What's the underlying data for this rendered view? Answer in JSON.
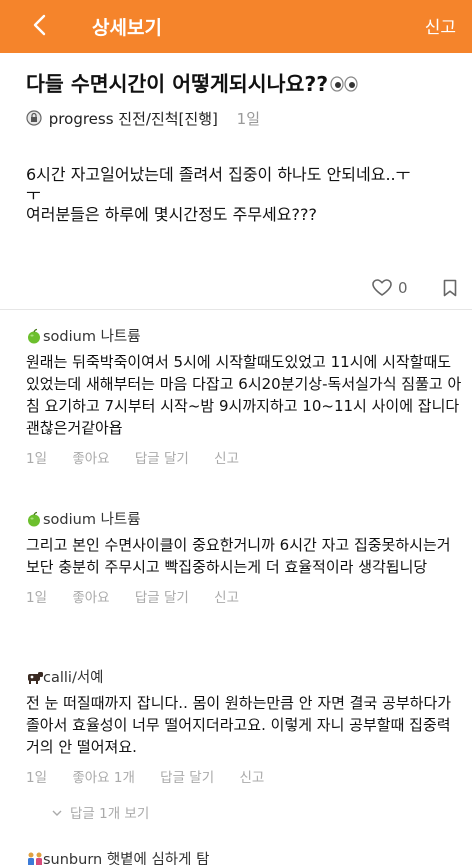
{
  "header": {
    "back_icon": "chevron-left-icon",
    "title": "상세보기",
    "report_label": "신고",
    "bg_color": "#f5842b"
  },
  "post": {
    "title": "다들 수면시간이 어떻게되시나요??",
    "title_emoji_icon": "eyes-icon",
    "author_icon": "lock-icon",
    "author": "progress 진전/진척[진행]",
    "time": "1일",
    "body_lines": [
      "6시간 자고일어났는데 졸려서 집중이 하나도 안되네요..ㅜ",
      "ㅜ",
      "여러분들은 하루에 몇시간정도 주무세요???"
    ],
    "like_count": "0",
    "like_icon": "heart-icon",
    "bookmark_icon": "bookmark-icon"
  },
  "comments": [
    {
      "icon": "apple-icon",
      "author": "sodium 나트륨",
      "text": "원래는 뒤죽박죽이여서 5시에 시작할때도있었고 11시에 시작할때도 있었는데 새해부터는 마음 다잡고 6시20분기상-독서실가식 짐풀고 아침 요기하고 7시부터 시작~밤 9시까지하고 10~11시 사이에 잡니다 괜찮은거같아욥",
      "time": "1일",
      "like": "좋아요",
      "reply": "답글 달기",
      "report": "신고"
    },
    {
      "icon": "apple-icon",
      "author": "sodium 나트륨",
      "text": "그리고 본인 수면사이클이 중요한거니까 6시간 자고 집중못하시는거보단 충분히 주무시고 빡집중하시는게 더 효율적이라 생각됩니당",
      "time": "1일",
      "like": "좋아요",
      "reply": "답글 달기",
      "report": "신고"
    },
    {
      "icon": "cow-icon",
      "author": "calli/서예",
      "text": "전 눈 떠질때까지 잡니다.. 몸이 원하는만큼 안 자면 결국 공부하다가 졸아서 효율성이 너무 떨어지더라고요. 이렇게 자니 공부할때 집중력 거의 안 떨어져요.",
      "time": "1일",
      "like": "좋아요 1개",
      "reply": "답글 달기",
      "report": "신고"
    },
    {
      "icon": "people-icon",
      "author": "sunburn 햇볕에 심하게 탐"
    }
  ],
  "replies_toggle": {
    "icon": "chevron-down-icon",
    "label": "답글 1개 보기"
  }
}
